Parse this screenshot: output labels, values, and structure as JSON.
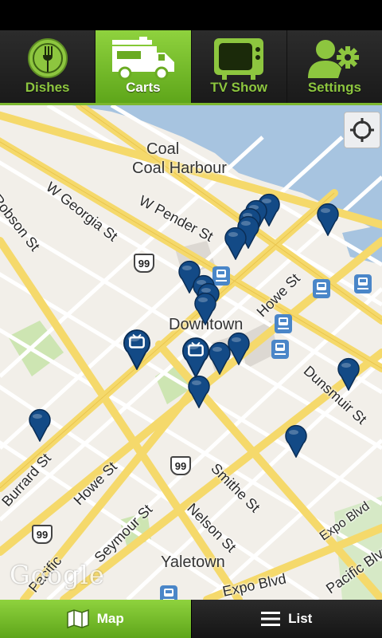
{
  "nav": {
    "tabs": [
      {
        "label": "Dishes",
        "icon": "fork-icon"
      },
      {
        "label": "Carts",
        "icon": "food-truck-icon"
      },
      {
        "label": "TV Show",
        "icon": "tv-icon"
      },
      {
        "label": "Settings",
        "icon": "user-settings-icon"
      }
    ],
    "active": "Carts",
    "accent": "#8dc63f"
  },
  "map": {
    "areas": {
      "coal_harbour": "Coal Harbour",
      "downtown": "Downtown",
      "yaletown": "Yaletown"
    },
    "streets": {
      "robson": "Robson St",
      "w_georgia": "W Georgia St",
      "w_pender": "W Pender St",
      "howe_1": "Howe St",
      "howe_2": "Howe St",
      "dunsmuir": "Dunsmuir St",
      "burrard": "Burrard St",
      "seymour": "Seymour St",
      "nelson": "Nelson St",
      "smithe": "Smithe St",
      "expo_1": "Expo Blvd",
      "expo_2": "Expo Blvd",
      "pacific_1": "Pacific Blvd",
      "pacific_2": "Pacific"
    },
    "highway": "99",
    "attribution": "Google",
    "pin_color": "#134a86"
  },
  "bottom": {
    "map_label": "Map",
    "list_label": "List",
    "active": "Map"
  }
}
